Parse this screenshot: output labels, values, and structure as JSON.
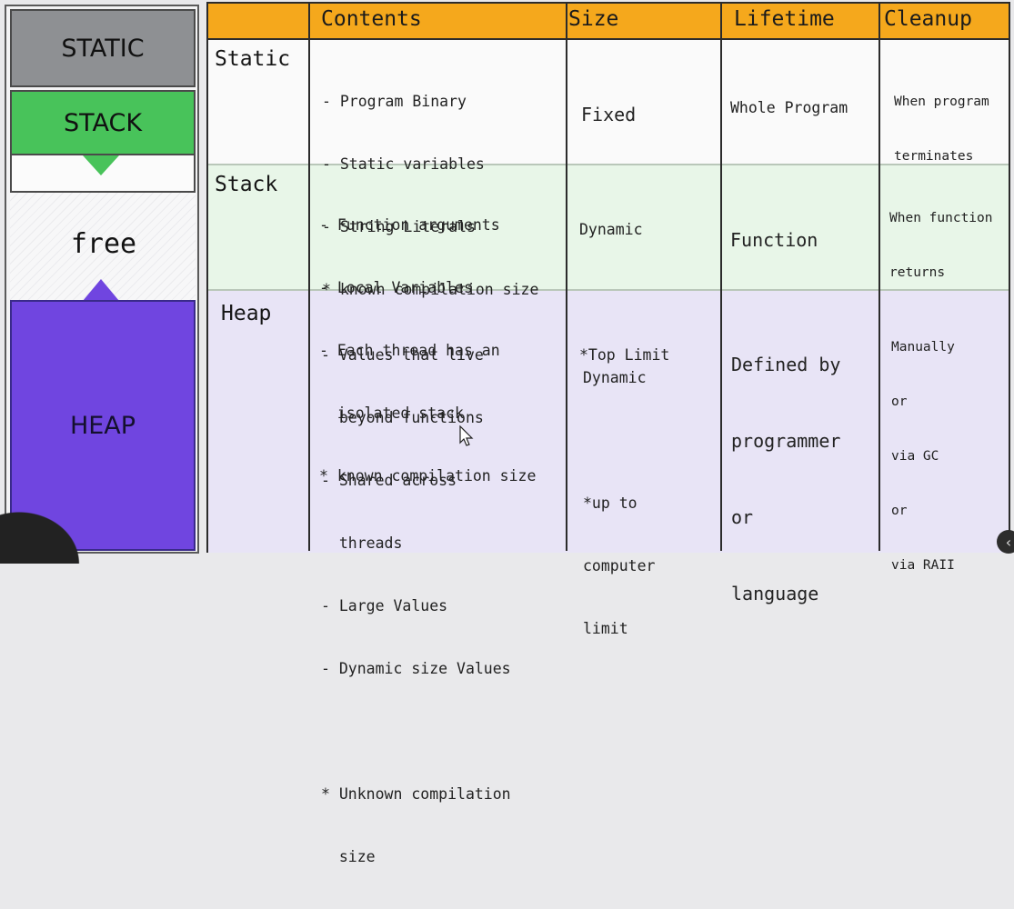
{
  "diagram": {
    "static_label": "STATIC",
    "stack_label": "STACK",
    "free_label": "free",
    "heap_label": "HEAP",
    "colors": {
      "static": "#8e9093",
      "stack": "#48c35a",
      "heap": "#7045e0"
    }
  },
  "table": {
    "headers": [
      "Contents",
      "Size",
      "Lifetime",
      "Cleanup"
    ],
    "header_color": "#f5a81c",
    "rows": [
      {
        "name": "Static",
        "contents": [
          "- Program Binary",
          "- Static variables",
          "- String Literals",
          "* known compilation size"
        ],
        "size": [
          "Fixed"
        ],
        "lifetime": [
          "Whole Program"
        ],
        "cleanup": [
          "When program",
          "terminates"
        ]
      },
      {
        "name": "Stack",
        "contents": [
          "- Function arguments",
          "- Local Variables",
          "- Each thread has an",
          "  isolated stack",
          "* known compilation size"
        ],
        "size": [
          "Dynamic",
          "",
          "*Top Limit"
        ],
        "lifetime": [
          "Function"
        ],
        "cleanup": [
          "When function",
          "returns"
        ]
      },
      {
        "name": "Heap",
        "contents": [
          "- Values that live",
          "  beyond functions",
          "- Shared across",
          "  threads",
          "- Large Values",
          "- Dynamic size Values",
          "",
          "* Unknown compilation",
          "  size"
        ],
        "size": [
          "Dynamic",
          "",
          "*up to",
          "computer",
          "limit"
        ],
        "lifetime": [
          "Defined by",
          "programmer",
          "or",
          "language"
        ],
        "cleanup": [
          "Manually",
          "or",
          "via GC",
          "or",
          "via RAII"
        ]
      }
    ]
  }
}
